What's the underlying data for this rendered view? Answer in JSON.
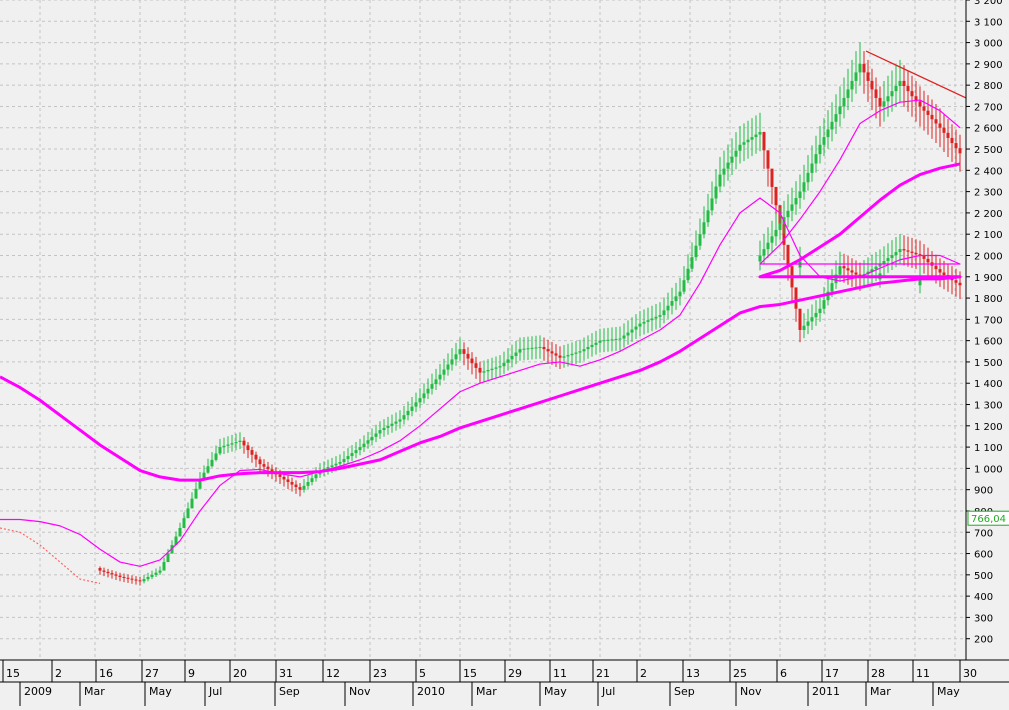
{
  "chart_data": {
    "type": "line",
    "title": "",
    "xlabel": "",
    "ylabel": "",
    "ylim": [
      100,
      3200
    ],
    "grid": true,
    "y_ticks": [
      200,
      300,
      400,
      500,
      600,
      700,
      800,
      900,
      1000,
      1100,
      1200,
      1300,
      1400,
      1500,
      1600,
      1700,
      1800,
      1900,
      2000,
      2100,
      2200,
      2300,
      2400,
      2500,
      2600,
      2700,
      2800,
      2900,
      3000,
      3100,
      3200
    ],
    "y_tick_labels": [
      "200",
      "300",
      "400",
      "500",
      "600",
      "700",
      "800",
      "900",
      "1 000",
      "1 100",
      "1 200",
      "1 300",
      "1 400",
      "1 500",
      "1 600",
      "1 700",
      "1 800",
      "1 900",
      "2 000",
      "2 100",
      "2 200",
      "2 300",
      "2 400",
      "2 500",
      "2 600",
      "2 700",
      "2 800",
      "2 900",
      "3 000",
      "3 100",
      "3 200"
    ],
    "x_axis_days": [
      "15",
      "2",
      "16",
      "27",
      "9",
      "20",
      "31",
      "12",
      "23",
      "5",
      "15",
      "29",
      "11",
      "21",
      "2",
      "13",
      "25",
      "6",
      "17",
      "28",
      "11",
      "30"
    ],
    "x_axis_months": [
      "2009",
      "Mar",
      "May",
      "Jul",
      "Sep",
      "Nov",
      "2010",
      "Mar",
      "May",
      "Jul",
      "Sep",
      "Nov",
      "2011",
      "Mar",
      "May"
    ],
    "x": [
      0,
      20,
      40,
      60,
      80,
      100,
      120,
      140,
      160,
      180,
      200,
      220,
      240,
      260,
      280,
      300,
      320,
      340,
      360,
      380,
      400,
      420,
      440,
      460,
      480,
      500,
      520,
      540,
      560,
      580,
      600,
      620,
      640,
      660,
      680,
      700,
      720,
      740,
      760,
      780,
      800,
      820,
      840,
      860,
      880,
      900,
      920,
      940,
      960
    ],
    "series": [
      {
        "color": "#22bb44",
        "down_color": "#dd2222",
        "values": [
          760,
          740,
          700,
          650,
          580,
          520,
          490,
          470,
          520,
          720,
          950,
          1100,
          1130,
          1020,
          960,
          900,
          990,
          1030,
          1100,
          1180,
          1230,
          1330,
          1440,
          1560,
          1450,
          1480,
          1560,
          1570,
          1520,
          1550,
          1600,
          1610,
          1680,
          1720,
          1830,
          2100,
          2380,
          2520,
          2580,
          2150,
          1650,
          1750,
          1950,
          1900,
          1960,
          2030,
          2000,
          1920,
          1860
        ]
      },
      {
        "color": "#ff00ff",
        "values": [
          760,
          760,
          750,
          730,
          690,
          620,
          560,
          540,
          570,
          660,
          800,
          920,
          990,
          995,
          975,
          960,
          985,
          1010,
          1040,
          1080,
          1130,
          1200,
          1280,
          1360,
          1400,
          1430,
          1460,
          1490,
          1500,
          1480,
          1510,
          1550,
          1600,
          1650,
          1720,
          1870,
          2050,
          2200,
          2270,
          2200,
          2000,
          1900,
          1880,
          1900,
          1940,
          1980,
          2000,
          2000,
          1960
        ]
      },
      {
        "color": "#ff00ff",
        "values": [
          1430,
          1380,
          1320,
          1250,
          1180,
          1110,
          1050,
          990,
          960,
          945,
          945,
          965,
          975,
          980,
          980,
          980,
          985,
          1000,
          1020,
          1040,
          1080,
          1120,
          1150,
          1190,
          1220,
          1250,
          1280,
          1310,
          1340,
          1370,
          1400,
          1430,
          1460,
          1500,
          1550,
          1610,
          1670,
          1730,
          1760,
          1770,
          1790,
          1810,
          1830,
          1850,
          1870,
          1880,
          1890,
          1890,
          1900
        ]
      }
    ],
    "extension": {
      "x": [
        740,
        760,
        780,
        800,
        820,
        840,
        860,
        880,
        900,
        920,
        940,
        960
      ],
      "price": [
        1880,
        2000,
        2150,
        2300,
        2520,
        2700,
        2900,
        2700,
        2820,
        2700,
        2600,
        2480
      ],
      "ma_short": [
        1920,
        1960,
        2050,
        2170,
        2300,
        2450,
        2620,
        2680,
        2720,
        2730,
        2680,
        2600
      ],
      "ma_long": [
        1890,
        1900,
        1930,
        1980,
        2040,
        2100,
        2180,
        2260,
        2330,
        2380,
        2410,
        2430
      ]
    },
    "early_price_dotted": {
      "color": "#ff6666",
      "x": [
        0,
        20,
        40,
        60,
        80,
        100
      ],
      "values": [
        720,
        700,
        640,
        560,
        480,
        460
      ]
    },
    "trendline": {
      "color": "#dd2222",
      "x1": 866,
      "y1": 2960,
      "x2": 966,
      "y2": 2740
    },
    "last_value_label": "766,04",
    "last_value_y": 766,
    "last_value_color": "#22aa22"
  }
}
